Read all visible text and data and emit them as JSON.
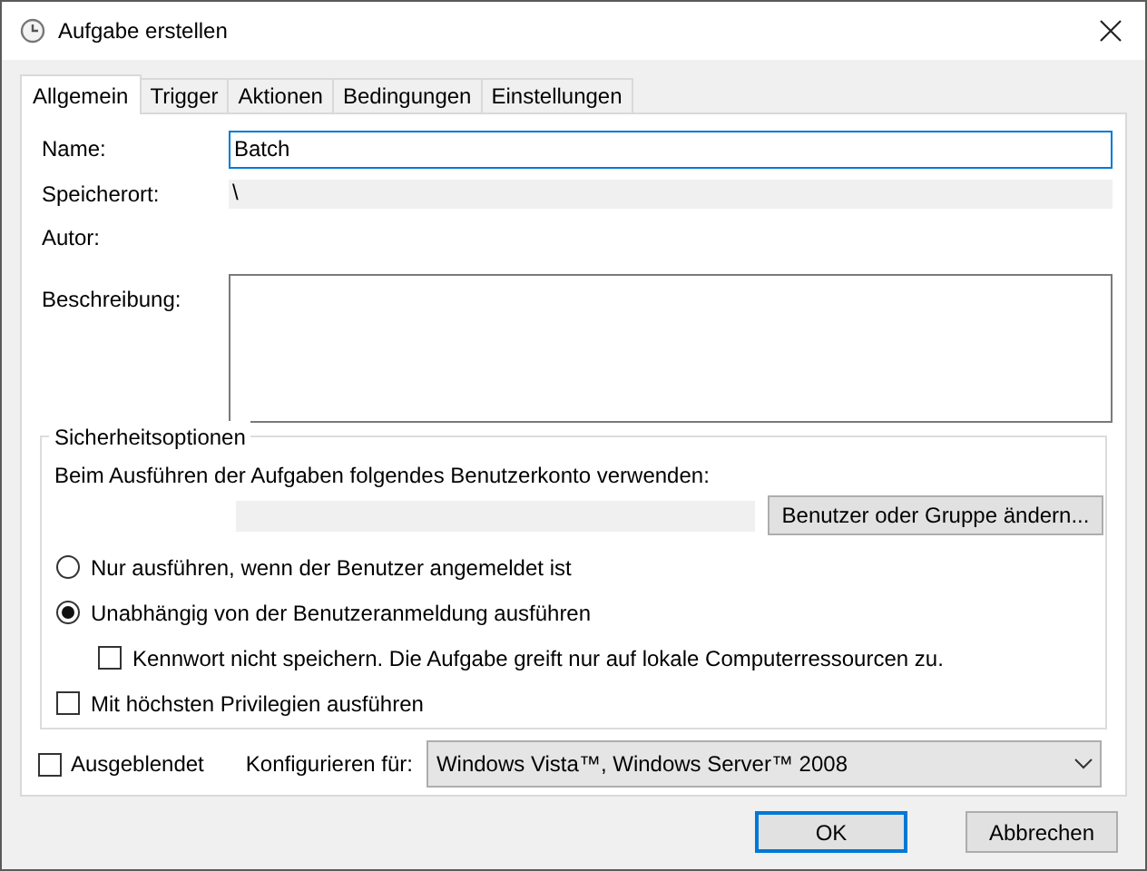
{
  "window": {
    "title": "Aufgabe erstellen"
  },
  "tabs": [
    {
      "label": "Allgemein",
      "selected": true
    },
    {
      "label": "Trigger",
      "selected": false
    },
    {
      "label": "Aktionen",
      "selected": false
    },
    {
      "label": "Bedingungen",
      "selected": false
    },
    {
      "label": "Einstellungen",
      "selected": false
    }
  ],
  "general": {
    "name": {
      "label": "Name:",
      "value": "Batch"
    },
    "location": {
      "label": "Speicherort:",
      "value": "\\"
    },
    "author": {
      "label": "Autor:"
    },
    "description": {
      "label": "Beschreibung:"
    }
  },
  "security": {
    "title": "Sicherheitsoptionen",
    "account_prompt": "Beim Ausführen der Aufgaben folgendes Benutzerkonto verwenden:",
    "change_button": "Benutzer oder Gruppe ändern...",
    "options": [
      {
        "kind": "radio",
        "label": "Nur ausführen, wenn der Benutzer angemeldet ist",
        "checked": false
      },
      {
        "kind": "radio",
        "label": "Unabhängig von der Benutzeranmeldung ausführen",
        "checked": true,
        "children": [
          {
            "kind": "checkbox",
            "label": "Kennwort nicht speichern. Die Aufgabe greift nur auf lokale Computerressourcen zu.",
            "checked": false
          }
        ]
      },
      {
        "kind": "checkbox",
        "label": "Mit höchsten Privilegien ausführen",
        "checked": false
      }
    ]
  },
  "hidden": {
    "label": "Ausgeblendet",
    "checked": false
  },
  "configure": {
    "label": "Konfigurieren für:",
    "value": "Windows Vista™, Windows Server™ 2008"
  },
  "buttons": [
    {
      "label": "OK",
      "default": true
    },
    {
      "label": "Abbrechen",
      "default": false
    }
  ]
}
